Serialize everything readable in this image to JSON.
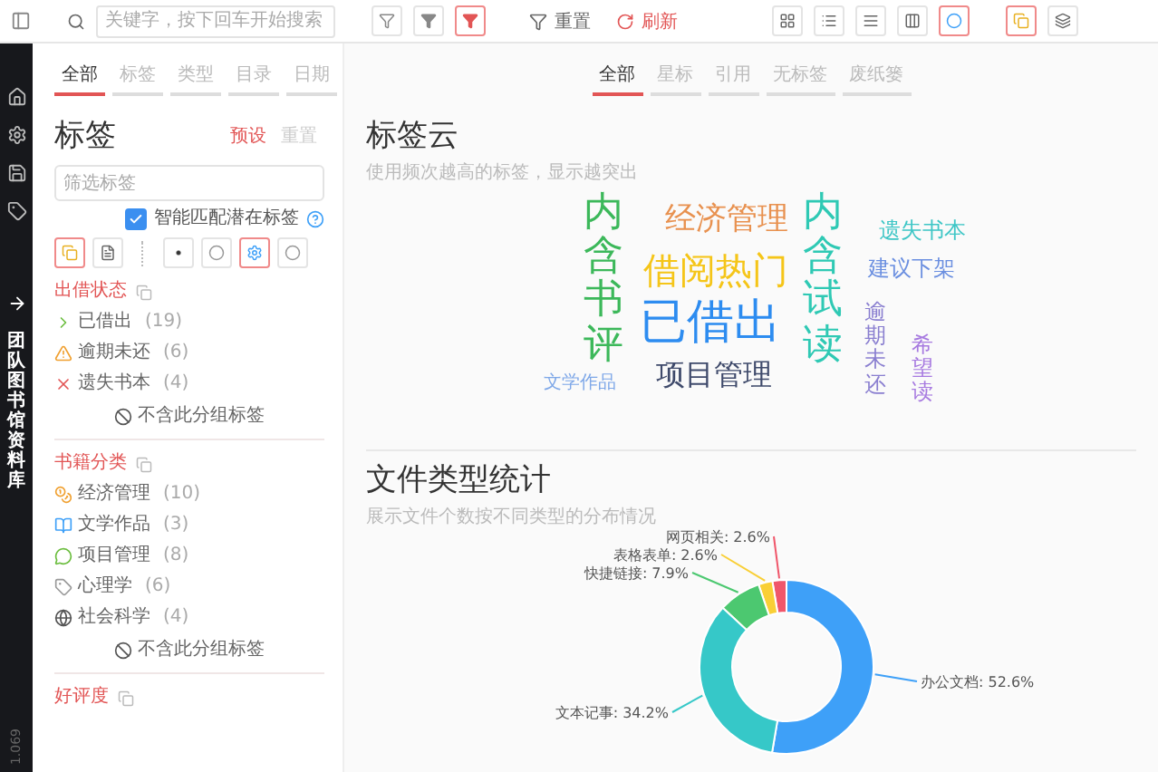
{
  "toolbar": {
    "search_placeholder": "关键字，按下回车开始搜索",
    "filter_buttons": [
      {
        "selected": false
      },
      {
        "selected": false
      },
      {
        "selected": true
      }
    ],
    "reset_label": "重置",
    "refresh_label": "刷新",
    "view_buttons": [
      {
        "selected": false
      },
      {
        "selected": false
      },
      {
        "selected": false
      },
      {
        "selected": false
      },
      {
        "selected": true
      }
    ],
    "extra_buttons": [
      {
        "selected": true
      },
      {
        "selected": false
      }
    ]
  },
  "rail": {
    "label": "团队图书馆资料库",
    "version": "1.069"
  },
  "left_tabs": [
    {
      "label": "全部",
      "selected": true
    },
    {
      "label": "标签",
      "selected": false
    },
    {
      "label": "类型",
      "selected": false
    },
    {
      "label": "目录",
      "selected": false
    },
    {
      "label": "日期",
      "selected": false
    }
  ],
  "tag_panel": {
    "title": "标签",
    "preset": "预设",
    "reset": {
      "label": "重置",
      "disabled": true
    },
    "filter_placeholder": "筛选标签",
    "smart_match": {
      "label": "智能匹配潜在标签",
      "checked": true
    },
    "mode_buttons": [
      {
        "selected": true
      },
      {
        "selected": false
      }
    ],
    "style_buttons": [
      {
        "selected": false
      },
      {
        "selected": false
      },
      {
        "selected": true
      },
      {
        "selected": false
      }
    ],
    "groups": [
      {
        "title": "出借状态",
        "items": [
          {
            "kind": "arrow",
            "label": "已借出",
            "count": "(19)"
          },
          {
            "kind": "warning",
            "label": "逾期未还",
            "count": "(6)"
          },
          {
            "kind": "cross",
            "label": "遗失书本",
            "count": "(4)"
          }
        ],
        "exclude_label": "不含此分组标签"
      },
      {
        "title": "书籍分类",
        "items": [
          {
            "kind": "coin",
            "label": "经济管理",
            "count": "(10)"
          },
          {
            "kind": "book",
            "label": "文学作品",
            "count": "(3)"
          },
          {
            "kind": "chat",
            "label": "项目管理",
            "count": "(8)"
          },
          {
            "kind": "tag",
            "label": "心理学",
            "count": "(6)"
          },
          {
            "kind": "globe",
            "label": "社会科学",
            "count": "(4)"
          }
        ],
        "exclude_label": "不含此分组标签"
      },
      {
        "title": "好评度"
      }
    ]
  },
  "right_tabs": [
    {
      "label": "全部",
      "selected": true
    },
    {
      "label": "星标",
      "selected": false
    },
    {
      "label": "引用",
      "selected": false
    },
    {
      "label": "无标签",
      "selected": false
    },
    {
      "label": "废纸篓",
      "selected": false
    }
  ],
  "tag_cloud": {
    "title": "标签云",
    "subtitle": "使用频次越高的标签，显示越突出",
    "words": [
      {
        "text": "内含书评",
        "color": "#3cb85a",
        "kind": "vertical"
      },
      {
        "text": "经济管理",
        "color": "#e8914f",
        "kind": "horizontal"
      },
      {
        "text": "内含试读",
        "color": "#2fc9b4",
        "kind": "vertical"
      },
      {
        "text": "遗失书本",
        "color": "#3ec6c6",
        "kind": "horizontal"
      },
      {
        "text": "借阅热门",
        "color": "#f5c518",
        "kind": "horizontal"
      },
      {
        "text": "建议下架",
        "color": "#6b8fe0",
        "kind": "horizontal"
      },
      {
        "text": "已借出",
        "color": "#2d8cf0",
        "kind": "horizontal"
      },
      {
        "text": "文学作品",
        "color": "#7fa8e8",
        "kind": "horizontal"
      },
      {
        "text": "项目管理",
        "color": "#3f4a6b",
        "kind": "horizontal"
      },
      {
        "text": "逾期未还",
        "color": "#8a7fd0",
        "kind": "vertical"
      },
      {
        "text": "希望读",
        "color": "#a77ae0",
        "kind": "vertical"
      }
    ]
  },
  "file_types": {
    "title": "文件类型统计",
    "subtitle": "展示文件个数按不同类型的分布情况",
    "slices": [
      {
        "label": "网页相关: 2.6%",
        "color": "#f0566a"
      },
      {
        "label": "表格表单: 2.6%",
        "color": "#f9cf36"
      },
      {
        "label": "快捷链接: 7.9%",
        "color": "#4cc870"
      },
      {
        "label": "办公文档: 52.6%",
        "color": "#3ea0f8"
      },
      {
        "label": "文本记事: 34.2%",
        "color": "#36c8c8"
      }
    ],
    "chart_data": {
      "type": "donut",
      "values": [
        2.6,
        2.6,
        7.9,
        52.6,
        34.2
      ]
    }
  }
}
